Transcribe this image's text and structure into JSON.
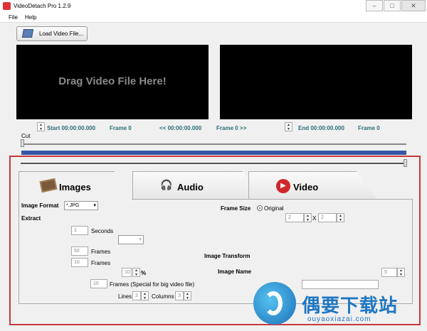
{
  "window": {
    "title": "VideoDetach Pro 1.2.9"
  },
  "menu": {
    "file": "File",
    "help": "Help"
  },
  "toolbar": {
    "load_label": "Load Video File..."
  },
  "preview": {
    "drag_text": "Drag Video File Here!"
  },
  "timeline": {
    "start": "Start 00:00:00.000",
    "start_frame": "Frame 0",
    "current": "<< 00:00:00.000",
    "current_frame": "Frame 0 >>",
    "end": "End 00:00:00.000",
    "end_frame": "Frame 0",
    "cut_label": "Cut"
  },
  "tabs": {
    "images": "Images",
    "audio": "Audio",
    "video": "Video"
  },
  "images": {
    "format_label": "Image Format",
    "format_value": "*.JPG",
    "extract_label": "Extract",
    "seconds_value": "1",
    "seconds_label": "Seconds",
    "frames_value_1": "50",
    "frames_label_1": "Frames",
    "frames_value_2": "10",
    "frames_label_2": "Frames",
    "percent_value": "10",
    "percent_label": "%",
    "frames_value_3": "10",
    "frames_label_3": "Frames (Special for big video file)",
    "lines_label": "Lines",
    "lines_value": "2",
    "columns_label": "Columns",
    "columns_value": "3",
    "frame_size_label": "Frame Size",
    "original_label": "Original",
    "width_value": "2",
    "times_label": "X",
    "height_value": "2",
    "transform_label": "Image Transform",
    "name_label": "Image Name",
    "name_counter": "5",
    "name_value": ""
  },
  "watermark": {
    "text": "偶要下载站",
    "sub": "ouyaoxiazai.com"
  },
  "colors": {
    "accent": "#2b6d75",
    "frame_border": "#c8393b",
    "bar": "#3457a8"
  }
}
